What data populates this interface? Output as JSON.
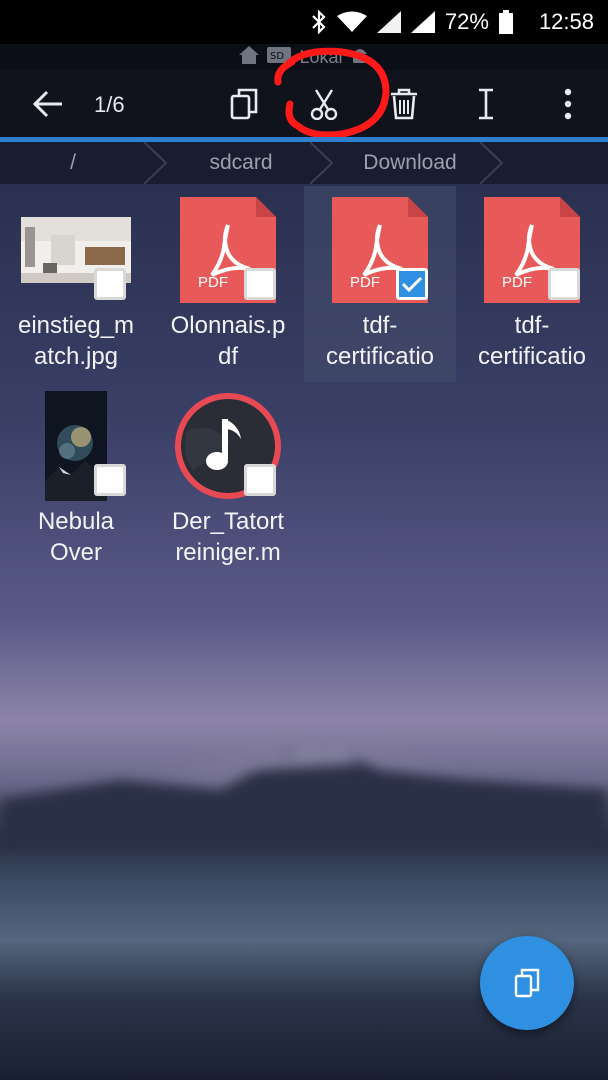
{
  "status_bar": {
    "battery_percent": "72%",
    "time": "12:58",
    "icons": [
      "bluetooth-icon",
      "wifi-icon",
      "signal-icon",
      "signal-icon",
      "battery-icon"
    ]
  },
  "location": {
    "label": "Lokal",
    "icons": [
      "home-icon",
      "sd-card-icon",
      "android-icon"
    ]
  },
  "toolbar": {
    "selection_count": "1/6",
    "actions": [
      "back-arrow-icon",
      "copy-icon",
      "cut-icon",
      "delete-icon",
      "rename-icon",
      "more-icon"
    ]
  },
  "breadcrumb": {
    "items": [
      "/",
      "sdcard",
      "Download"
    ]
  },
  "files": [
    {
      "name": "einstieg_m\natch.jpg",
      "type": "image",
      "checked": false
    },
    {
      "name": "Olonnais.p\ndf",
      "type": "pdf",
      "checked": false
    },
    {
      "name": "tdf-\ncertificatio",
      "type": "pdf",
      "checked": true
    },
    {
      "name": "tdf-\ncertificatio",
      "type": "pdf",
      "checked": false
    },
    {
      "name": "Nebula\nOver",
      "type": "image",
      "checked": false
    },
    {
      "name": "Der_Tatort\nreiniger.m",
      "type": "audio",
      "checked": false
    }
  ],
  "pdf_badge": "PDF",
  "fab": {
    "icon": "paste-icon"
  },
  "colors": {
    "accent": "#2f8fe0",
    "pdf_red": "#e85a5a",
    "annotation_red": "#ff1a1a"
  }
}
